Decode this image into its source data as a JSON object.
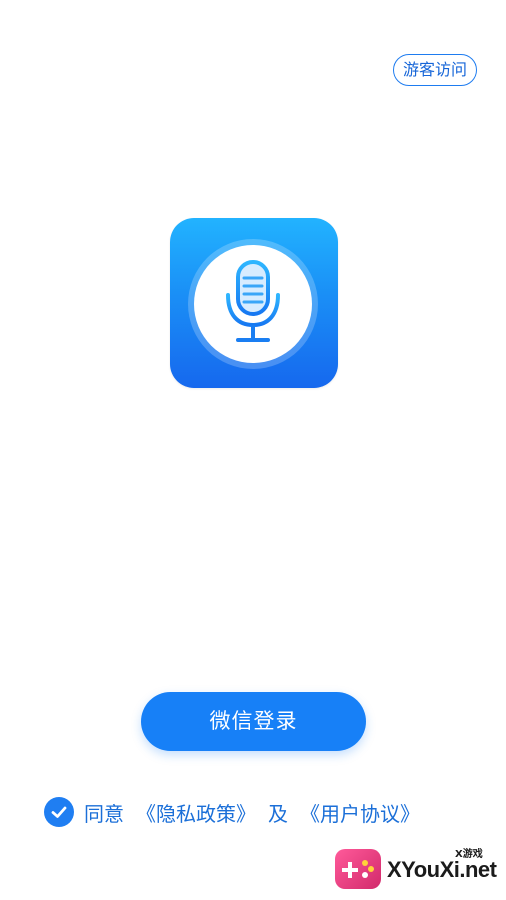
{
  "header": {
    "guest_label": "游客访问"
  },
  "app_icon": {
    "icon": "microphone-icon",
    "color": "#1a8ff6"
  },
  "login": {
    "wechat_label": "微信登录"
  },
  "agreement": {
    "checked": true,
    "prefix": "同意",
    "privacy_link": "《隐私政策》",
    "conjunction": "及",
    "user_agreement_link": "《用户协议》"
  },
  "watermark": {
    "site": "XYouXi.net",
    "small": "X游戏"
  },
  "colors": {
    "accent": "#1780f7",
    "link": "#1b6fd8"
  }
}
